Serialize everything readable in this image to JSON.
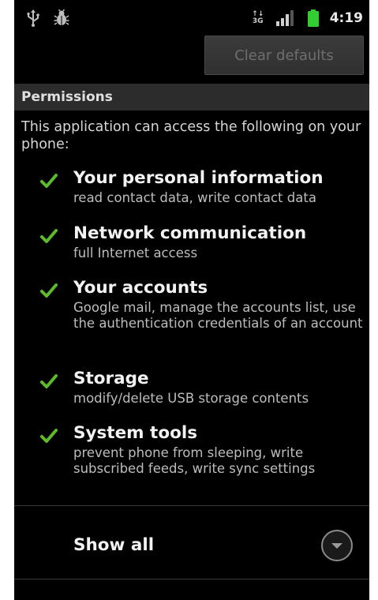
{
  "status_bar": {
    "left_icons": [
      "usb-icon",
      "debug-icon"
    ],
    "data_indicator_top": "↑↓",
    "data_indicator_bottom": "3G",
    "signal_level": 0.75,
    "battery_level": 1.0,
    "time": "4:19",
    "battery_color": "#33cc33"
  },
  "toolbar": {
    "clear_defaults_label": "Clear defaults"
  },
  "permissions": {
    "header": "Permissions",
    "intro": "This application can access the following on your phone:",
    "check_color": "#5dbb2a",
    "items": [
      {
        "title": "Your personal information",
        "description": "read contact data, write contact data"
      },
      {
        "title": "Network communication",
        "description": "full Internet access"
      },
      {
        "title": "Your accounts",
        "description": "Google mail, manage the accounts list, use the authentication credentials of an account"
      },
      {
        "title": "Storage",
        "description": "modify/delete USB storage contents"
      },
      {
        "title": "System tools",
        "description": "prevent phone from sleeping, write subscribed feeds, write sync settings"
      }
    ],
    "show_all_label": "Show all"
  }
}
